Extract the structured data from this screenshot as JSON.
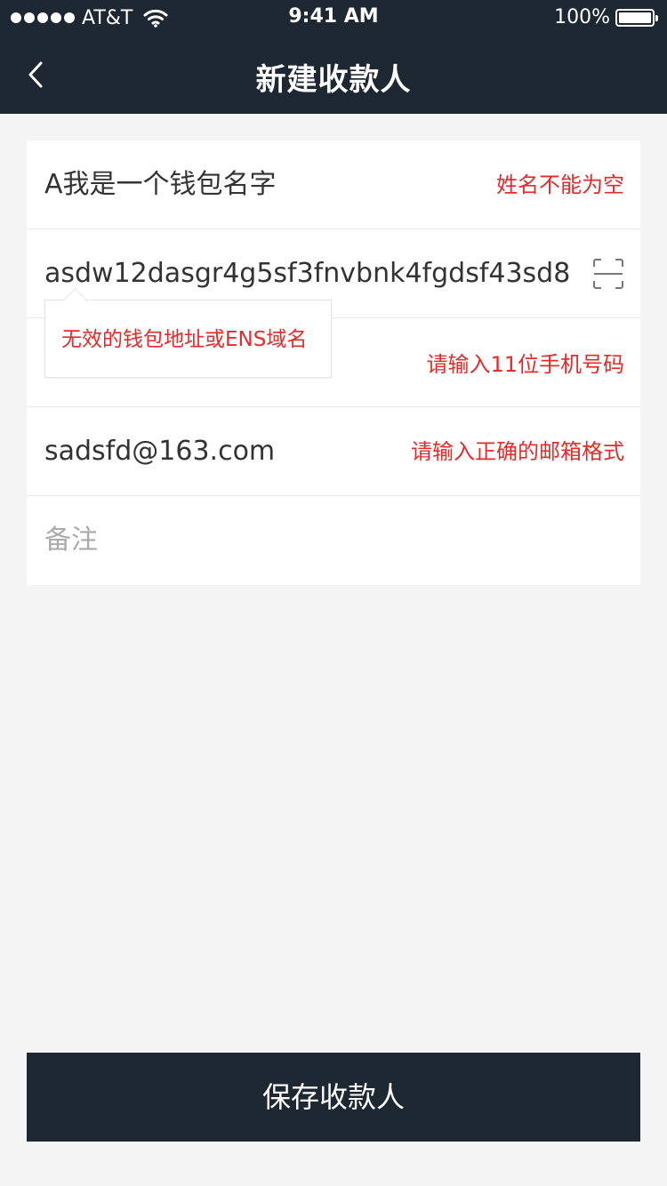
{
  "status_bar": {
    "carrier": "AT&T",
    "time": "9:41 AM",
    "battery": "100%"
  },
  "nav": {
    "title": "新建收款人"
  },
  "form": {
    "name": {
      "value": "A我是一个钱包名字",
      "error": "姓名不能为空"
    },
    "address": {
      "value": "asdw12dasgr4g5sf3fnvbnk4fgdsf43sd8",
      "tooltip": "无效的钱包地址或ENS域名"
    },
    "phone": {
      "value": "",
      "error": "请输入11位手机号码"
    },
    "email": {
      "value": "sadsfd@163.com",
      "error": "请输入正确的邮箱格式"
    },
    "note": {
      "placeholder": "备注"
    }
  },
  "save_button": {
    "label": "保存收款人"
  },
  "colors": {
    "header_bg": "#1e2833",
    "error": "#e22b2b",
    "page_bg": "#f4f4f4"
  },
  "icons": [
    "back-chevron-icon",
    "scan-icon",
    "wifi-icon",
    "battery-icon"
  ]
}
